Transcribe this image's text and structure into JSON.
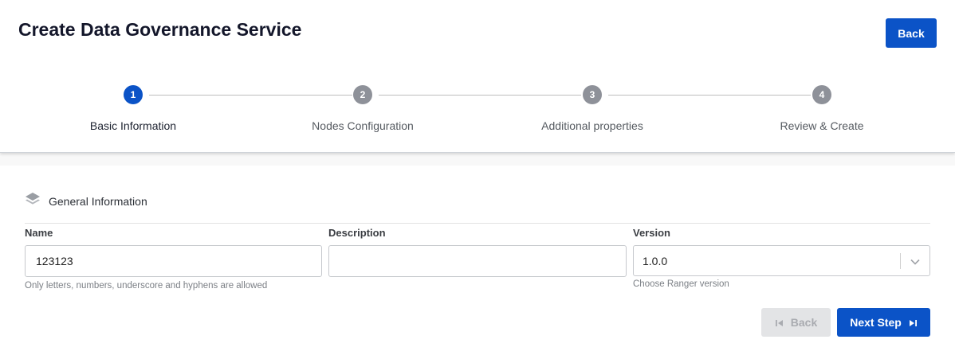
{
  "header": {
    "title": "Create Data Governance Service",
    "back_label": "Back"
  },
  "stepper": {
    "steps": [
      {
        "number": "1",
        "label": "Basic Information",
        "active": true
      },
      {
        "number": "2",
        "label": "Nodes Configuration",
        "active": false
      },
      {
        "number": "3",
        "label": "Additional properties",
        "active": false
      },
      {
        "number": "4",
        "label": "Review & Create",
        "active": false
      }
    ]
  },
  "section": {
    "title": "General Information",
    "icon": "layers-icon"
  },
  "form": {
    "name": {
      "label": "Name",
      "value": "123123",
      "hint": "Only letters, numbers, underscore and hyphens are allowed"
    },
    "description": {
      "label": "Description",
      "value": ""
    },
    "version": {
      "label": "Version",
      "value": "1.0.0",
      "hint": "Choose Ranger version"
    }
  },
  "footer": {
    "back_label": "Back",
    "next_label": "Next Step"
  },
  "colors": {
    "primary": "#0b53c7",
    "step_inactive": "#8e9199",
    "disabled_bg": "#e3e4e6"
  }
}
